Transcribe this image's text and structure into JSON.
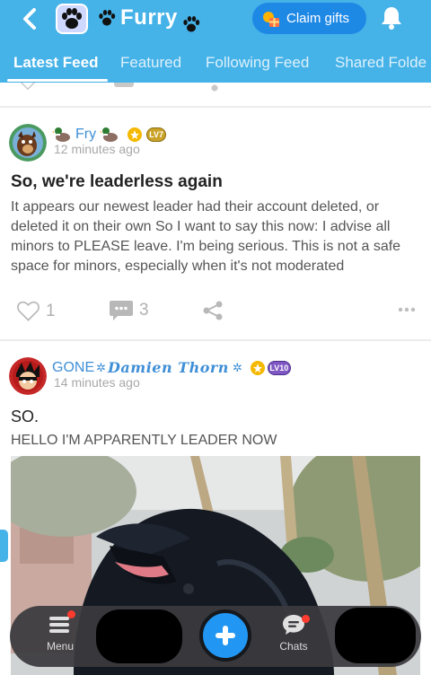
{
  "header": {
    "community_name": "Furry",
    "claim_gifts_label": "Claim gifts",
    "brand_color": "#45b2e8"
  },
  "tabs": [
    {
      "label": "Latest Feed",
      "active": true
    },
    {
      "label": "Featured",
      "active": false
    },
    {
      "label": "Following Feed",
      "active": false
    },
    {
      "label": "Shared Folde",
      "active": false
    }
  ],
  "posts": [
    {
      "author": "Fry",
      "level_badge": "LV7",
      "time": "12 minutes ago",
      "title": "So, we're leaderless again",
      "body": "It appears our newest leader had their account deleted, or deleted it on their own So I want to say this now: I advise all minors to PLEASE leave. I'm being serious. This is not a safe space for minors, especially when it's not moderated",
      "likes": "1",
      "comments": "3"
    },
    {
      "author_prefix": "GONE",
      "author_script": "Damien Thorn",
      "level_badge": "LV10",
      "time": "14 minutes ago",
      "title": "SO.",
      "body": "HELLO I'M APPARENTLY LEADER NOW"
    }
  ],
  "bottom_nav": {
    "menu_label": "Menu",
    "chats_label": "Chats"
  },
  "icons": {
    "back": "chevron-left-icon",
    "bell": "bell-icon",
    "like": "heart-icon",
    "comment": "comment-icon",
    "share": "share-icon",
    "more": "more-icon",
    "compose": "plus-icon"
  }
}
